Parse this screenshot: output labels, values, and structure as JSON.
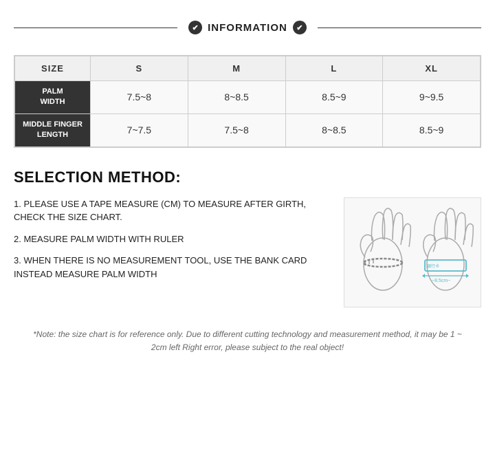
{
  "header": {
    "title": "INFORMATION",
    "left_icon": "✔",
    "right_icon": "✔"
  },
  "table": {
    "col_headers": [
      "SIZE",
      "S",
      "M",
      "L",
      "XL"
    ],
    "rows": [
      {
        "label": "PALM\nWIDTH",
        "values": [
          "7.5~8",
          "8~8.5",
          "8.5~9",
          "9~9.5"
        ]
      },
      {
        "label": "MIDDLE FINGER\nLENGTH",
        "values": [
          "7~7.5",
          "7.5~8",
          "8~8.5",
          "8.5~9"
        ]
      }
    ]
  },
  "selection": {
    "title": "SELECTION METHOD:",
    "steps": [
      "1. PLEASE USE A TAPE MEASURE (CM) TO MEASURE AFTER GIRTH, CHECK THE SIZE CHART.",
      "2. MEASURE PALM WIDTH WITH RULER",
      "3. WHEN THERE IS NO MEASUREMENT TOOL, USE THE BANK CARD INSTEAD MEASURE PALM WIDTH"
    ]
  },
  "note": {
    "text": "*Note: the size chart is for reference only. Due to different cutting technology and measurement method, it may be 1 ~ 2cm left Right error, please subject to the real object!"
  }
}
